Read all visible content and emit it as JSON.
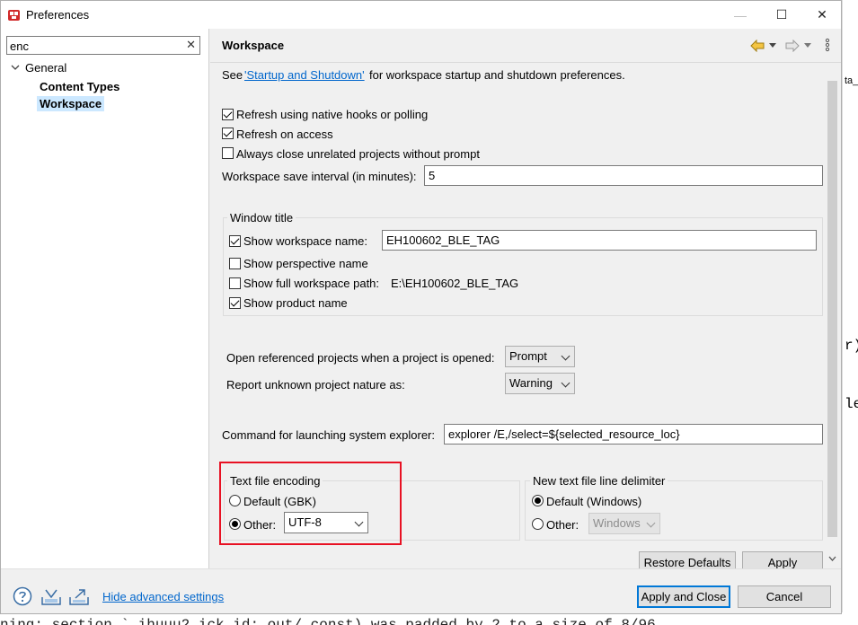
{
  "window": {
    "title": "Preferences",
    "minimize": "—",
    "maximize": "☐",
    "close": "✕"
  },
  "left": {
    "filter_value": "enc",
    "filter_clear": "✕",
    "tree": {
      "general": "General",
      "content_types": "Content Types",
      "workspace": "Workspace"
    }
  },
  "header": {
    "title": "Workspace"
  },
  "intro": {
    "see": "See",
    "link": "'Startup and Shutdown'",
    "rest": "for workspace startup and shutdown preferences."
  },
  "checks": {
    "native_hooks": {
      "label": "Refresh using native hooks or polling",
      "checked": true
    },
    "on_access": {
      "label": "Refresh on access",
      "checked": true
    },
    "close_unrelated": {
      "label": "Always close unrelated projects without prompt",
      "checked": false
    }
  },
  "save_interval": {
    "label": "Workspace save interval (in minutes):",
    "value": "5"
  },
  "window_title": {
    "group_label": "Window title",
    "show_workspace_name": {
      "label": "Show workspace name:",
      "checked": true,
      "value": "EH100602_BLE_TAG"
    },
    "show_perspective_name": {
      "label": "Show perspective name",
      "checked": false
    },
    "show_full_path": {
      "label": "Show full workspace path:",
      "checked": false,
      "value": "E:\\EH100602_BLE_TAG"
    },
    "show_product_name": {
      "label": "Show product name",
      "checked": true
    }
  },
  "open_referenced": {
    "label": "Open referenced projects when a project is opened:",
    "value": "Prompt"
  },
  "report_unknown": {
    "label": "Report unknown project nature as:",
    "value": "Warning"
  },
  "explorer": {
    "label": "Command for launching system explorer:",
    "value": "explorer /E,/select=${selected_resource_loc}"
  },
  "encoding": {
    "group_label": "Text file encoding",
    "default_label": "Default (GBK)",
    "other_label": "Other:",
    "other_value": "UTF-8",
    "selected": "other"
  },
  "line_delimiter": {
    "group_label": "New text file line delimiter",
    "default_label": "Default (Windows)",
    "other_label": "Other:",
    "other_value": "Windows",
    "selected": "default"
  },
  "buttons": {
    "restore_defaults": "Restore Defaults",
    "apply": "Apply",
    "apply_and_close": "Apply and Close",
    "cancel": "Cancel"
  },
  "footer": {
    "hide_advanced": "Hide advanced settings"
  },
  "background": {
    "frag1": "ta_",
    "frag2": "r)",
    "frag3": "le",
    "bottom_line": "ning: section `.ihuuu2 ick id: out/ const) was padded by 2 to a size of 8/96"
  },
  "colors": {
    "accent": "#0078d7",
    "highlight": "#e81123",
    "link": "#0066cc",
    "selection": "#cce8ff"
  }
}
